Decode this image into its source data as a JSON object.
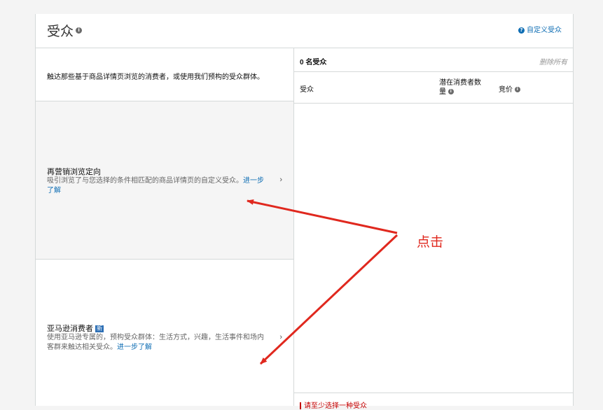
{
  "header": {
    "title": "受众",
    "custom_link": "自定义受众"
  },
  "left": {
    "intro": "触达那些基于商品详情页浏览的消费者，或使用我们预构的受众群体。",
    "options": [
      {
        "title": "再营销浏览定向",
        "desc": "吸引浏览了与您选择的条件相匹配的商品详情页的自定义受众。",
        "link": "进一步了解"
      },
      {
        "title": "亚马逊消费者",
        "badge": "新",
        "desc": "使用亚马逊专属的，预构受众群体：生活方式，兴趣，生活事件和场内客群来触达相关受众。",
        "link": "进一步了解"
      }
    ]
  },
  "right": {
    "count": "0 名受众",
    "remove_all": "删除所有",
    "columns": [
      "受众",
      "潜在消费者数量",
      "竞价"
    ],
    "warning": "请至少选择一种受众"
  },
  "annotation": {
    "label": "点击",
    "color": "#e0281e"
  },
  "icons": [
    "info-icon",
    "help-icon",
    "chevron-right-icon",
    "new-badge"
  ],
  "colors": {
    "link": "#0f6eb4",
    "warning": "#c40000",
    "selected_bg": "#f5f5f5"
  }
}
